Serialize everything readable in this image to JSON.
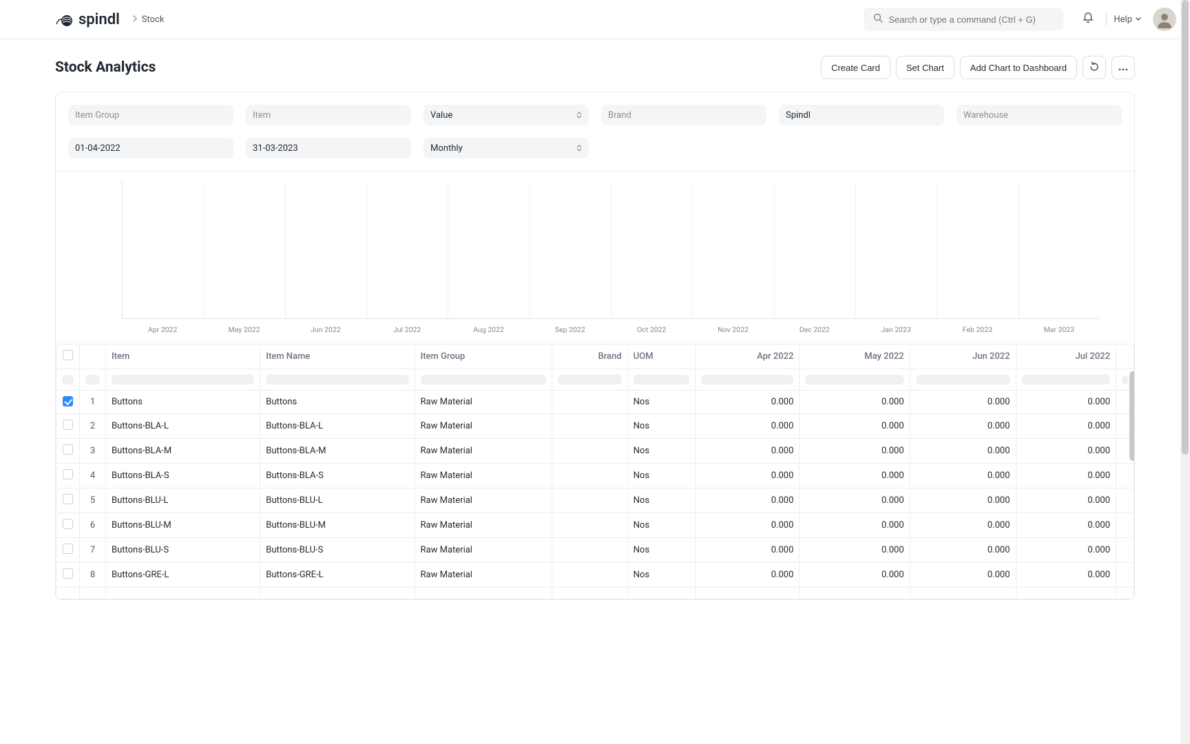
{
  "brand": "spindl",
  "breadcrumb": {
    "current": "Stock"
  },
  "search": {
    "placeholder": "Search or type a command (Ctrl + G)"
  },
  "nav": {
    "help": "Help"
  },
  "page": {
    "title": "Stock Analytics"
  },
  "actions": {
    "create_card": "Create Card",
    "set_chart": "Set Chart",
    "add_dashboard": "Add Chart to Dashboard"
  },
  "filters": {
    "item_group": {
      "placeholder": "Item Group",
      "value": ""
    },
    "item": {
      "placeholder": "Item",
      "value": ""
    },
    "value_based_on": {
      "value": "Value"
    },
    "brand": {
      "placeholder": "Brand",
      "value": ""
    },
    "company": {
      "value": "Spindl"
    },
    "warehouse": {
      "placeholder": "Warehouse",
      "value": ""
    },
    "from_date": {
      "value": "01-04-2022"
    },
    "to_date": {
      "value": "31-03-2023"
    },
    "range": {
      "value": "Monthly"
    }
  },
  "chart_data": {
    "type": "bar",
    "categories": [
      "Apr 2022",
      "May 2022",
      "Jun 2022",
      "Jul 2022",
      "Aug 2022",
      "Sep 2022",
      "Oct 2022",
      "Nov 2022",
      "Dec 2022",
      "Jan 2023",
      "Feb 2023",
      "Mar 2023"
    ],
    "values": [
      0,
      0,
      0,
      0,
      0,
      0,
      0,
      0,
      0,
      0,
      0,
      0
    ],
    "title": "",
    "ylabel": "",
    "ylim": [
      0,
      0
    ]
  },
  "table": {
    "columns": [
      "",
      "",
      "Item",
      "Item Name",
      "Item Group",
      "Brand",
      "UOM",
      "Apr 2022",
      "May 2022",
      "Jun 2022",
      "Jul 2022"
    ],
    "value_cols_numeric_from_index": 5,
    "rows": [
      {
        "checked": true,
        "idx": 1,
        "item": "Buttons",
        "name": "Buttons",
        "group": "Raw Material",
        "brand": "",
        "uom": "Nos",
        "apr": "0.000",
        "may": "0.000",
        "jun": "0.000",
        "jul": "0.000"
      },
      {
        "checked": false,
        "idx": 2,
        "item": "Buttons-BLA-L",
        "name": "Buttons-BLA-L",
        "group": "Raw Material",
        "brand": "",
        "uom": "Nos",
        "apr": "0.000",
        "may": "0.000",
        "jun": "0.000",
        "jul": "0.000"
      },
      {
        "checked": false,
        "idx": 3,
        "item": "Buttons-BLA-M",
        "name": "Buttons-BLA-M",
        "group": "Raw Material",
        "brand": "",
        "uom": "Nos",
        "apr": "0.000",
        "may": "0.000",
        "jun": "0.000",
        "jul": "0.000"
      },
      {
        "checked": false,
        "idx": 4,
        "item": "Buttons-BLA-S",
        "name": "Buttons-BLA-S",
        "group": "Raw Material",
        "brand": "",
        "uom": "Nos",
        "apr": "0.000",
        "may": "0.000",
        "jun": "0.000",
        "jul": "0.000"
      },
      {
        "checked": false,
        "idx": 5,
        "item": "Buttons-BLU-L",
        "name": "Buttons-BLU-L",
        "group": "Raw Material",
        "brand": "",
        "uom": "Nos",
        "apr": "0.000",
        "may": "0.000",
        "jun": "0.000",
        "jul": "0.000"
      },
      {
        "checked": false,
        "idx": 6,
        "item": "Buttons-BLU-M",
        "name": "Buttons-BLU-M",
        "group": "Raw Material",
        "brand": "",
        "uom": "Nos",
        "apr": "0.000",
        "may": "0.000",
        "jun": "0.000",
        "jul": "0.000"
      },
      {
        "checked": false,
        "idx": 7,
        "item": "Buttons-BLU-S",
        "name": "Buttons-BLU-S",
        "group": "Raw Material",
        "brand": "",
        "uom": "Nos",
        "apr": "0.000",
        "may": "0.000",
        "jun": "0.000",
        "jul": "0.000"
      },
      {
        "checked": false,
        "idx": 8,
        "item": "Buttons-GRE-L",
        "name": "Buttons-GRE-L",
        "group": "Raw Material",
        "brand": "",
        "uom": "Nos",
        "apr": "0.000",
        "may": "0.000",
        "jun": "0.000",
        "jul": "0.000"
      }
    ]
  }
}
